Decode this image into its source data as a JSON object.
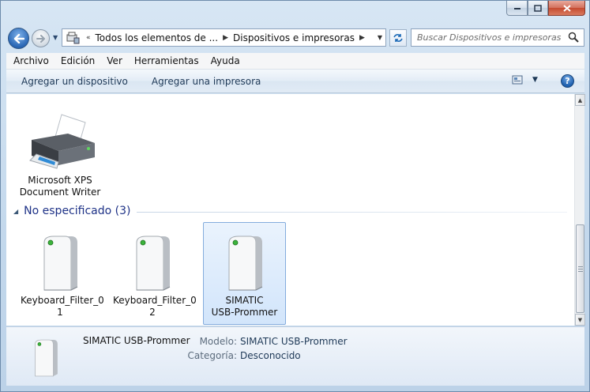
{
  "window": {
    "minimize_icon": "minimize-icon",
    "maximize_icon": "maximize-icon",
    "close_icon": "close-icon"
  },
  "nav": {
    "breadcrumb_overflow": "«",
    "breadcrumbs": [
      "Todos los elementos de ...",
      "Dispositivos e impresoras"
    ],
    "search_placeholder": "Buscar Dispositivos e impresoras"
  },
  "menu": {
    "items": [
      "Archivo",
      "Edición",
      "Ver",
      "Herramientas",
      "Ayuda"
    ]
  },
  "commands": {
    "add_device": "Agregar un dispositivo",
    "add_printer": "Agregar una impresora",
    "help": "?"
  },
  "printers": [
    {
      "line1": "Microsoft XPS",
      "line2": "Document Writer"
    }
  ],
  "group": {
    "title": "No especificado (3)"
  },
  "devices": [
    {
      "line1": "Keyboard_Filter_0",
      "line2": "1",
      "selected": false
    },
    {
      "line1": "Keyboard_Filter_0",
      "line2": "2",
      "selected": false
    },
    {
      "line1": "SIMATIC",
      "line2": "USB-Prommer",
      "selected": true
    }
  ],
  "details": {
    "name": "SIMATIC USB-Prommer",
    "model_label": "Modelo:",
    "model_value": "SIMATIC USB-Prommer",
    "category_label": "Categoría:",
    "category_value": "Desconocido"
  },
  "colors": {
    "accent": "#1e3287",
    "selection_border": "#84acdd"
  }
}
